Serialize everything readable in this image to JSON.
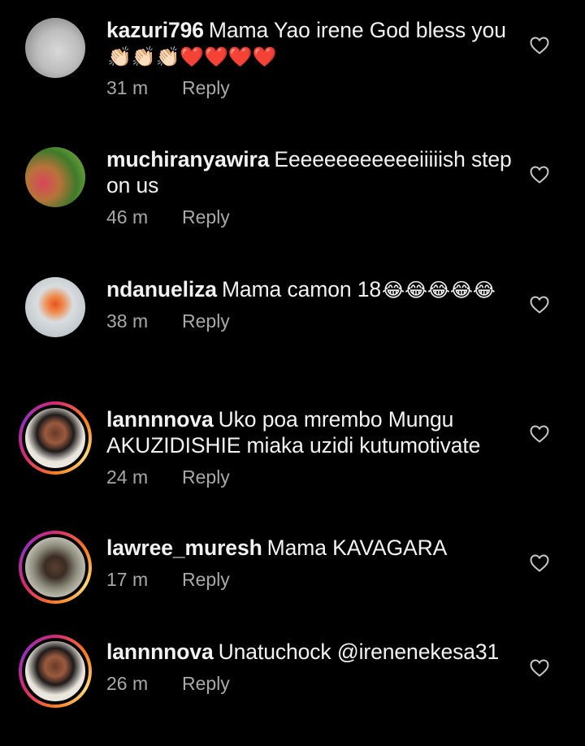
{
  "colors": {
    "background": "#000000",
    "text": "#f2f2f2",
    "meta": "#a8a8a8",
    "story_ring": "#d62976"
  },
  "reply_label": "Reply",
  "comments": [
    {
      "username": "kazuri796",
      "text": "Mama Yao irene God bless you",
      "emojis": "👏🏻👏🏻👏🏻❤️❤️❤️❤️",
      "time": "31 m",
      "icon": "heart-outline-icon"
    },
    {
      "username": "muchiranyawira",
      "text": "Eeeeeeeeeeeeiiiiish step on us",
      "emojis": "",
      "time": "46 m",
      "icon": "heart-outline-icon"
    },
    {
      "username": "ndanueliza",
      "text": "Mama camon 18",
      "emojis": "😂😂😂😂😂",
      "time": "38 m",
      "icon": "heart-outline-icon"
    },
    {
      "username": "lannnnova",
      "text": "Uko poa mrembo Mungu AKUZIDISHIE miaka uzidi kutumotivate",
      "emojis": "",
      "time": "24 m",
      "icon": "heart-outline-icon"
    },
    {
      "username": "lawree_muresh",
      "text": "Mama KAVAGARA",
      "emojis": "",
      "time": "17 m",
      "icon": "heart-outline-icon"
    },
    {
      "username": "lannnnova",
      "text": "Unatuchock @irenenekesa31",
      "emojis": "",
      "time": "26 m",
      "icon": "heart-outline-icon"
    }
  ]
}
